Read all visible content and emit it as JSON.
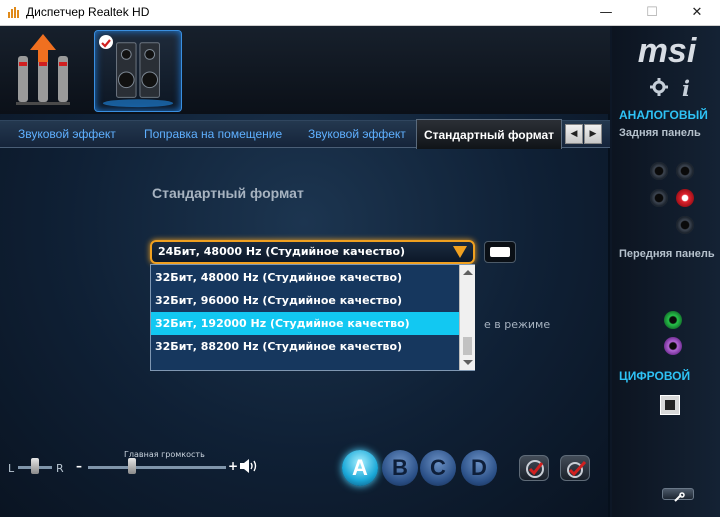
{
  "window": {
    "title": "Диспетчер Realtek HD",
    "minimize_glyph": "—",
    "maximize_glyph": "☐",
    "close_glyph": "✕"
  },
  "tabs": [
    {
      "label": "Звуковой эффект",
      "active": false
    },
    {
      "label": "Поправка на помещение",
      "active": false
    },
    {
      "label": "Звуковой эффект",
      "active": false
    },
    {
      "label": "Стандартный формат",
      "active": true
    }
  ],
  "tab_scroll": {
    "left": "◀",
    "right": "▶"
  },
  "content": {
    "section_title": "Стандартный формат",
    "selected_format": "24Бит, 48000 Hz (Студийное качество)",
    "dropdown_options": [
      {
        "label": "32Бит, 48000 Hz (Студийное качество)",
        "highlighted": false
      },
      {
        "label": "32Бит, 96000 Hz (Студийное качество)",
        "highlighted": false
      },
      {
        "label": "32Бит, 192000 Hz (Студийное качество)",
        "highlighted": true
      },
      {
        "label": "32Бит, 88200 Hz (Студийное качество)",
        "highlighted": false
      }
    ],
    "background_text": "е в режиме"
  },
  "controls": {
    "balance_left": "L",
    "balance_right": "R",
    "volume_label": "Главная громкость",
    "volume_minus": "–",
    "volume_plus": "+",
    "volume_level": 0.32,
    "profiles": [
      "A",
      "B",
      "C",
      "D"
    ],
    "active_profile": "A"
  },
  "side": {
    "brand": "msi",
    "analog_header": "АНАЛОГОВЫЙ",
    "rear_panel": "Задняя панель",
    "front_panel": "Передняя панель",
    "digital_header": "ЦИФРОВОЙ",
    "info_glyph": "i"
  },
  "colors": {
    "accent_cyan": "#12c8f2",
    "tab_link": "#5fb0ff",
    "selection_border": "#f0a020",
    "side_header": "#2ec2f5"
  }
}
